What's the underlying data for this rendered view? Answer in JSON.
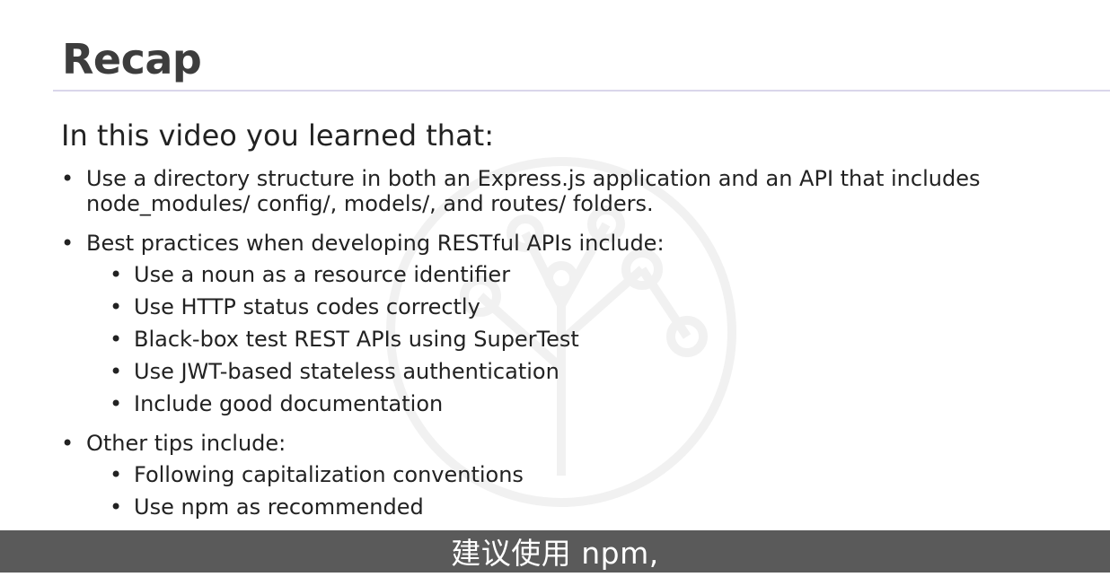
{
  "slide": {
    "title": "Recap",
    "intro": "In this video you learned that:",
    "bullets": [
      {
        "line1": "Use a directory structure in both an Express.js application and an API that includes",
        "line2": "node_modules/ config/, models/, and routes/ folders."
      },
      {
        "text": "Best practices when developing RESTful APIs include:",
        "sub": [
          "Use a noun as a resource identifier",
          "Use HTTP status codes correctly",
          "Black-box test REST APIs using SuperTest",
          "Use JWT-based stateless authentication",
          "Include good documentation"
        ]
      },
      {
        "text": "Other tips include:",
        "sub": [
          "Following capitalization conventions",
          "Use npm as recommended"
        ]
      }
    ]
  },
  "subtitle": "建议使用 npm,",
  "colors": {
    "title": "#3d3d3d",
    "text": "#222222",
    "rule": "#d9d6ea",
    "subtitle_bar": "#5a5a5a"
  }
}
